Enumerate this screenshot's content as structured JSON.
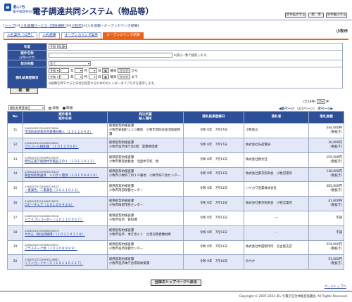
{
  "header": {
    "logo_main": "あいち",
    "logo_sub": "電子調達共同システム",
    "title": "電子調達共同システム（物品等）",
    "buttons": [
      "文字拡大する",
      "標　準",
      "文字縮小する"
    ]
  },
  "breadcrumb": [
    "トップ",
    "入札情報サービス（団体選択）",
    "小牧市",
    "入札情報・オープンカウンタ結果"
  ],
  "city": "小牧市",
  "tabs": [
    {
      "label": "入札案件（公告）",
      "active": false
    },
    {
      "label": "入札結果",
      "active": false
    },
    {
      "label": "オープンカウンタ案件",
      "active": false
    },
    {
      "label": "オープンカウンタ結果",
      "active": true
    }
  ],
  "form": {
    "year_label": "年度",
    "year_value": "令和 6年度",
    "name_label": "案件名称",
    "name_sublabel": "(全角50文字)",
    "name_note": "※部分一致で検索します。",
    "type_label": "発注形態",
    "type_value": "全て",
    "date_label": "開札結果登録日",
    "era": "令和",
    "unit_year": "年",
    "unit_month": "月",
    "unit_day": "日",
    "weekday_suffix": "曜日",
    "clear_label": "クリア",
    "from_label": "から",
    "to_label": "まで",
    "date_note": "※画像を押下すると日付を指定するためのカレンダーダイアログを表示します。",
    "search_button": "検　索"
  },
  "list_controls": {
    "sort_value": "開札結果登録日",
    "asc_label": "昇順",
    "desc_label": "降順",
    "desc_selected": true,
    "total": "(全18件)",
    "per_page": "10",
    "per_page_suffix": "件",
    "prev": "前ページ",
    "page_info": "（2/2ページ）",
    "next": "次ページ"
  },
  "table": {
    "headers": [
      "No",
      "案件番号\n案件名称",
      "発注所属\n納入場所",
      "開札結果登録日",
      "落札者",
      "落札金額"
    ],
    "rows": [
      {
        "no": "11",
        "id": "24062023219006225890",
        "name": "市消防本部救急用資機材購入（１０１１０４３）",
        "dept": "総務部契約検査課",
        "place": "小牧市安田町１１０番地　小牧市消防本部消防総務課",
        "date": "令和 6年　7月17日",
        "winner": "小牧防災",
        "amount": "344,000円",
        "tax": "(税抜き)"
      },
      {
        "no": "12",
        "id": "24062023219006225891",
        "name": "アルコール検知器　（１０１１０６６）",
        "dept": "総務部契約検査課",
        "place": "小牧市役所本庁舎4階　業務管理課",
        "date": "令和 6年　7月17日",
        "winner": "株式会社先進電研",
        "amount": "30,000円",
        "tax": "(税抜き)"
      },
      {
        "no": "13",
        "id": "24062023219006225520",
        "name": "特別支援学級教材等備品その１（１０１１０１３）",
        "dept": "総務部契約検査課",
        "place": "小牧市教育委員会　北里中学校　他",
        "date": "令和 6年　7月11日",
        "winner": "株式会社教文社",
        "amount": "155,000円",
        "tax": "(税抜き)"
      },
      {
        "no": "14",
        "id": "24062023219006225524",
        "name": "舞台照明用器具　ハロゲン電球（１０１０９４２４）",
        "dept": "総務部契約検査課",
        "place": "小牧市小牧四丁目１９番地　小牧市商工会センター",
        "date": "令和 6年　7月11日",
        "winner": "株式会社東京照商会　小牧営業所",
        "amount": "138,000円",
        "tax": "(税抜き)"
      },
      {
        "no": "15",
        "id": "24062023219006225522",
        "name": "一重兼色、二重兼色（１０１１０１１）",
        "dept": "総務部契約検査課",
        "place": "小牧市南部保健センター",
        "date": "令和 6年　7月11日",
        "winner": "ハヤカワ産業株式会社",
        "amount": "385,000円",
        "tax": "(税抜き)"
      },
      {
        "no": "16",
        "id": "24062023219006225523",
        "name": "ロビーチェア（１０１０９４２８）",
        "dept": "総務部契約検査課",
        "place": "小牧市味岡市民センター",
        "date": "令和 6年　7月11日",
        "winner": "株式会社東京照商会　小牧営業所",
        "amount": "41,600円",
        "tax": "(税抜き)"
      },
      {
        "no": "17",
        "id": "24062023219006225518",
        "name": "ドライブレコーダー（１０１１００６７）",
        "dept": "総務部契約検査課",
        "place": "小牧市役所　管財課",
        "date": "令和 6年　7月11日",
        "winner": "---",
        "amount": "不調",
        "tax": ""
      },
      {
        "no": "18",
        "id": "24062023219006225519",
        "name": "やかん（防災訓練用）（１０１１０１１８）",
        "dept": "総務部契約検査課",
        "place": "小牧市役所　本庁舎８１　災害対策資機材庫",
        "date": "令和 6年　7月11日",
        "winner": "---",
        "amount": "不調",
        "tax": ""
      },
      {
        "no": "19",
        "id": "24062023219006225521",
        "name": "プラスチック他（１０１０９９９９）",
        "dept": "総務部契約検査課",
        "place": "小牧市役所保健センター",
        "date": "令和 6年　7月11日",
        "winner": "株式会社中西製作所　名古屋支店",
        "amount": "254,000円",
        "tax": "(税抜き)"
      },
      {
        "no": "20",
        "id": "24062023219006224863",
        "name": "ソフトカードケース（１０１１０１１７）",
        "dept": "総務部契約検査課",
        "place": "小牧市役所本庁舎環境政策課",
        "date": "令和 6年　7月10日",
        "winner": "みやか",
        "amount": "51,000円",
        "tax": "(税抜き)"
      }
    ]
  },
  "footer": {
    "top_button": "団体のトップページへ戻る",
    "page_top": "ページトップへ",
    "copyright": "Copyright © 2007-2024 あいち電子自治体推進協議会, All Rights Reserved."
  },
  "colors": {
    "header_blue": "#2d4f97",
    "active_tab": "#e8641e",
    "row_alt": "#e3e8f8"
  }
}
